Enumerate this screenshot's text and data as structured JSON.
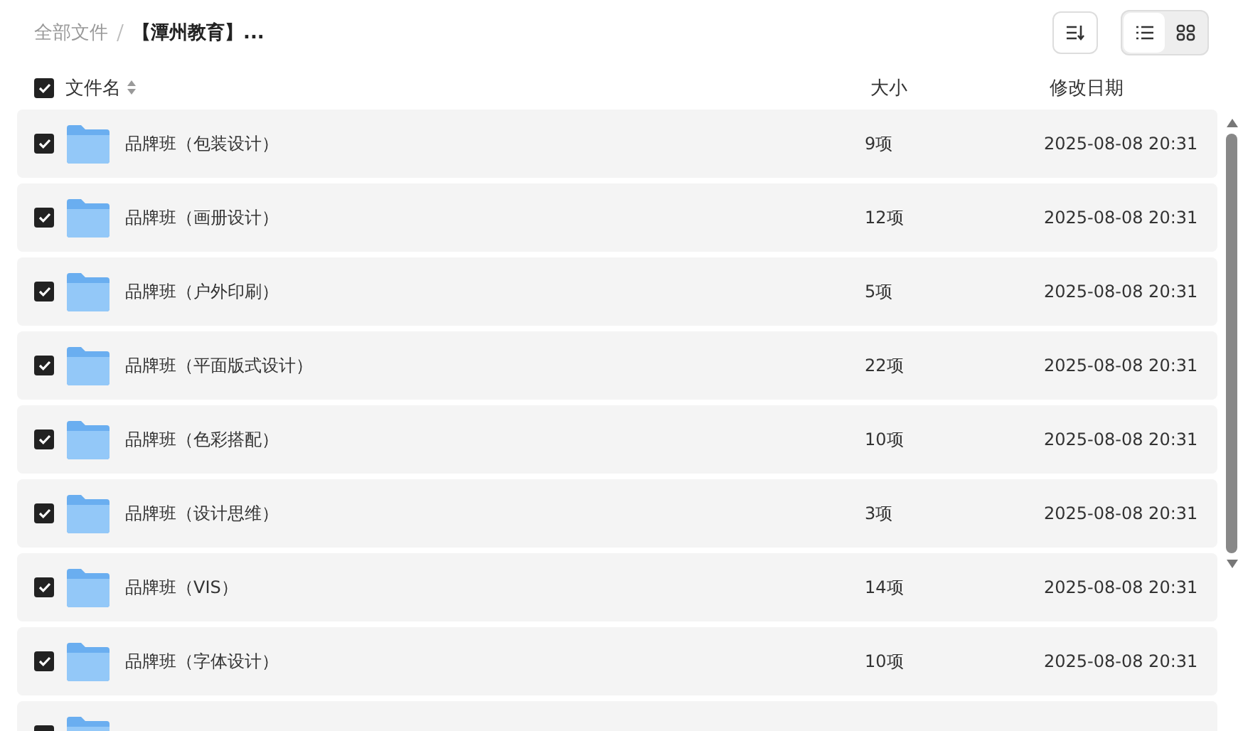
{
  "breadcrumb": [
    {
      "label": "全部文件",
      "current": false
    },
    {
      "label": "【潭州教育】...",
      "current": true
    }
  ],
  "toolbar": {
    "view_modes": [
      {
        "kind": "list",
        "selected": true
      },
      {
        "kind": "grid",
        "selected": false
      }
    ]
  },
  "table": {
    "all_checked": true,
    "columns": [
      "文件名",
      "大小",
      "修改日期"
    ],
    "rows": [
      {
        "checked": true,
        "name": "品牌班（包装设计）",
        "size": "9项",
        "modified": "2025-08-08 20:31"
      },
      {
        "checked": true,
        "name": "品牌班（画册设计）",
        "size": "12项",
        "modified": "2025-08-08 20:31"
      },
      {
        "checked": true,
        "name": "品牌班（户外印刷）",
        "size": "5项",
        "modified": "2025-08-08 20:31"
      },
      {
        "checked": true,
        "name": "品牌班（平面版式设计）",
        "size": "22项",
        "modified": "2025-08-08 20:31"
      },
      {
        "checked": true,
        "name": "品牌班（色彩搭配）",
        "size": "10项",
        "modified": "2025-08-08 20:31"
      },
      {
        "checked": true,
        "name": "品牌班（设计思维）",
        "size": "3项",
        "modified": "2025-08-08 20:31"
      },
      {
        "checked": true,
        "name": "品牌班（VIS）",
        "size": "14项",
        "modified": "2025-08-08 20:31"
      },
      {
        "checked": true,
        "name": "品牌班（字体设计）",
        "size": "10项",
        "modified": "2025-08-08 20:31"
      },
      {
        "checked": true
      }
    ]
  }
}
